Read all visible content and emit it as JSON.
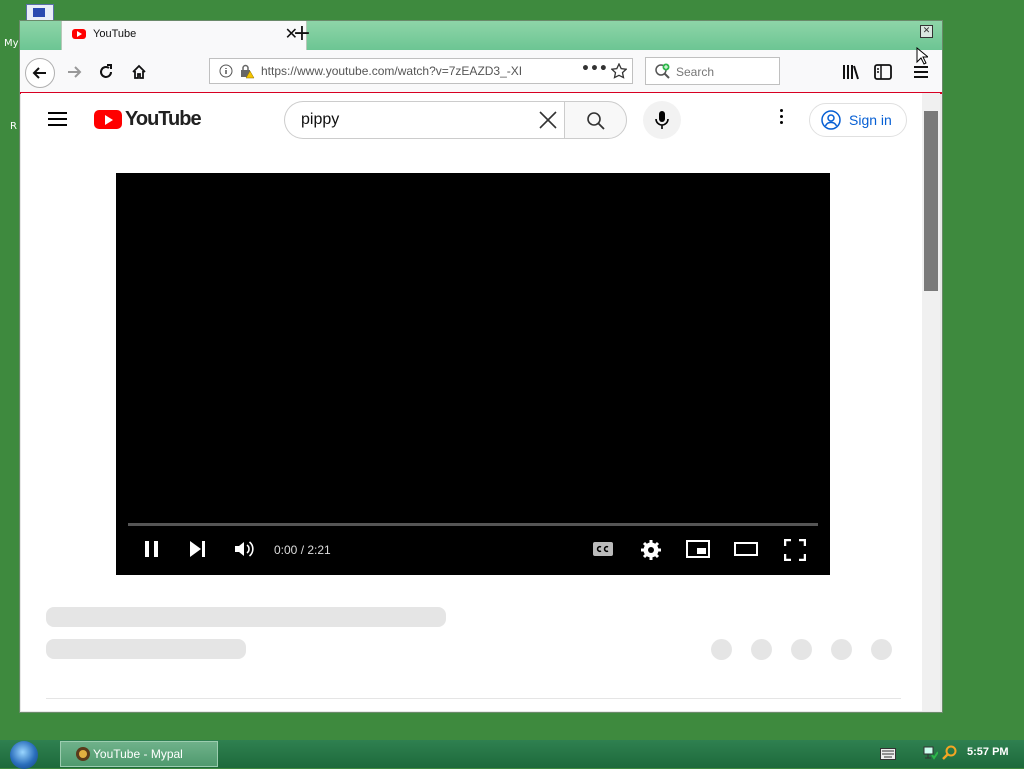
{
  "desktop": {
    "label_fragments": [
      "My",
      "R"
    ]
  },
  "browser": {
    "tab": {
      "title": "YouTube"
    },
    "url": "https://www.youtube.com/watch?v=7zEAZD3_-XI",
    "search_placeholder": "Search"
  },
  "youtube": {
    "logo_text": "YouTube",
    "search_query": "pippy",
    "sign_in_label": "Sign in"
  },
  "player": {
    "current_time": "0:00",
    "duration": "2:21",
    "time_display": "0:00 / 2:21",
    "progress_fraction": 0,
    "state": "playing"
  },
  "taskbar": {
    "item_label": "YouTube - Mypal",
    "clock": "5:57 PM"
  }
}
